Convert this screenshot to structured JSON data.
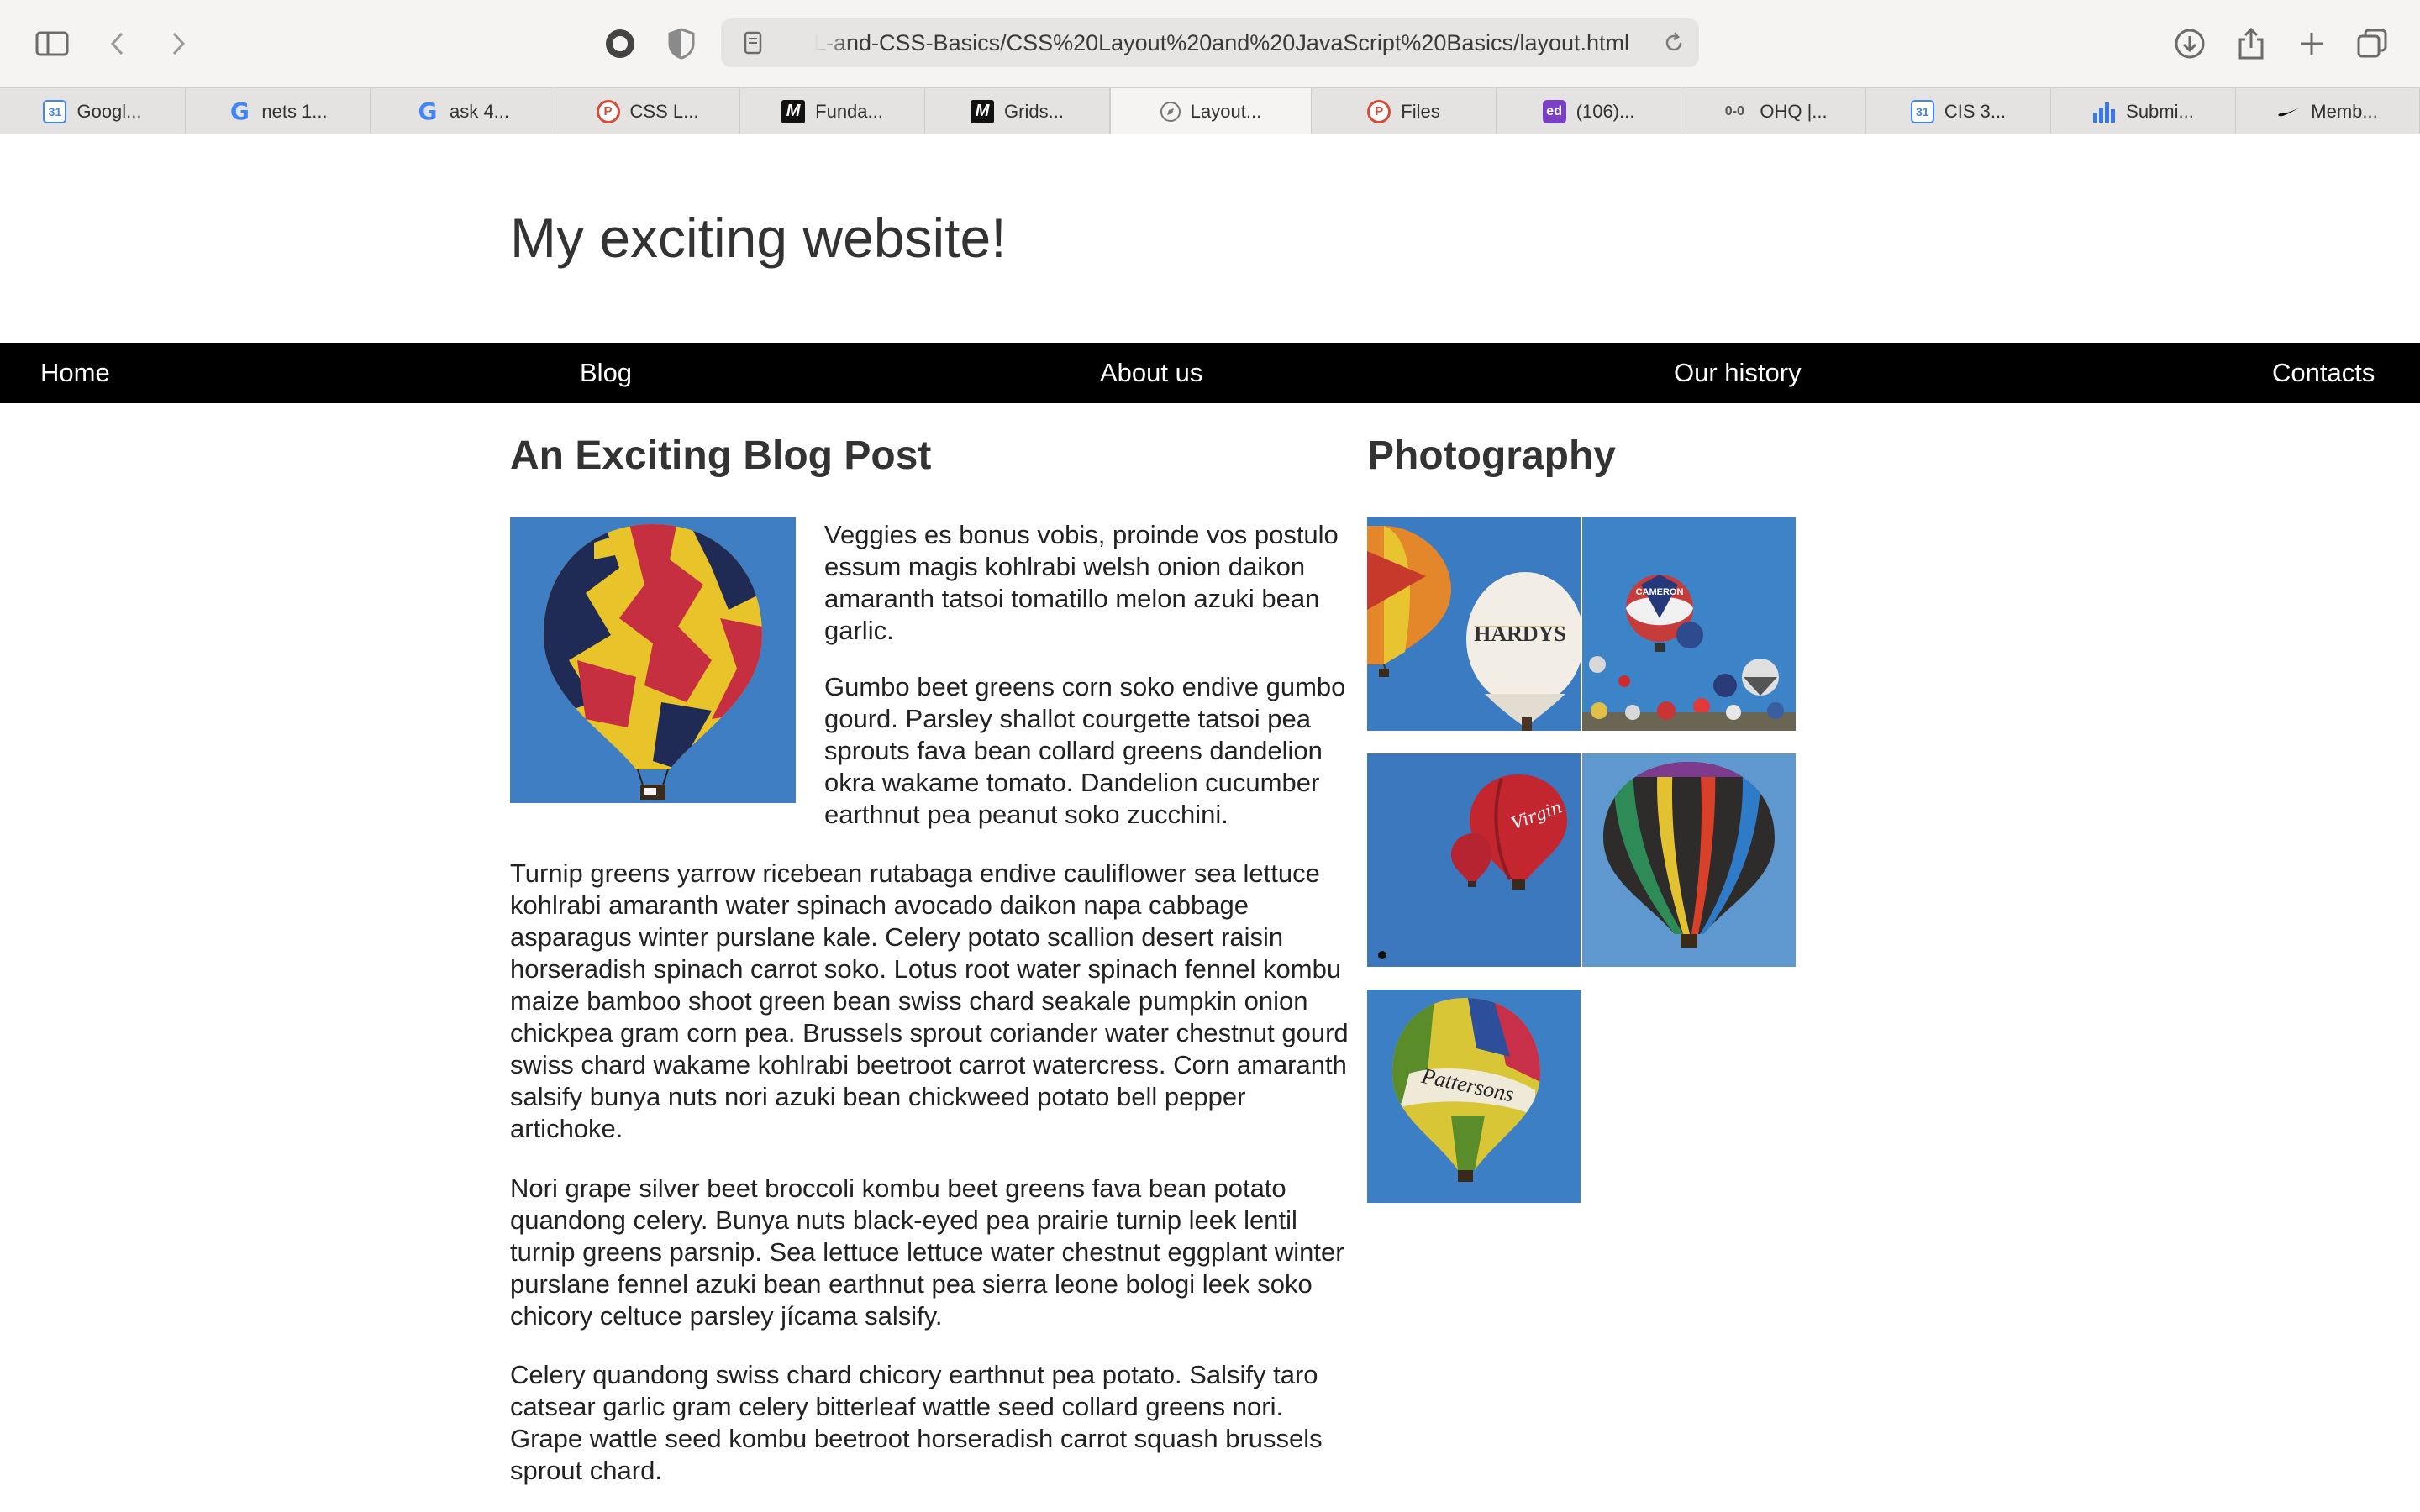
{
  "browser": {
    "url": "L-and-CSS-Basics/CSS%20Layout%20and%20JavaScript%20Basics/layout.html",
    "tabs": [
      {
        "label": "Googl...",
        "icon": "google-calendar-icon"
      },
      {
        "label": "nets 1...",
        "icon": "google-icon"
      },
      {
        "label": "ask 4...",
        "icon": "google-icon"
      },
      {
        "label": "CSS L...",
        "icon": "p-icon"
      },
      {
        "label": "Funda...",
        "icon": "m-icon"
      },
      {
        "label": "Grids...",
        "icon": "m-icon"
      },
      {
        "label": "Layout...",
        "icon": "compass-icon",
        "active": true
      },
      {
        "label": "Files",
        "icon": "p-icon"
      },
      {
        "label": "(106)...",
        "icon": "ed-icon"
      },
      {
        "label": "OHQ |...",
        "icon": "ohq-icon"
      },
      {
        "label": "CIS 3...",
        "icon": "google-calendar-icon"
      },
      {
        "label": "Submi...",
        "icon": "bar-chart-icon"
      },
      {
        "label": "Memb...",
        "icon": "nike-icon"
      }
    ]
  },
  "site": {
    "title": "My exciting website!",
    "nav": [
      "Home",
      "Blog",
      "About us",
      "Our history",
      "Contacts"
    ]
  },
  "post": {
    "title": "An Exciting Blog Post",
    "paragraphs": [
      "Veggies es bonus vobis, proinde vos postulo essum magis kohlrabi welsh onion daikon amaranth tatsoi tomatillo melon azuki bean garlic.",
      "Gumbo beet greens corn soko endive gumbo gourd. Parsley shallot courgette tatsoi pea sprouts fava bean collard greens dandelion okra wakame tomato. Dandelion cucumber earthnut pea peanut soko zucchini.",
      "Turnip greens yarrow ricebean rutabaga endive cauliflower sea lettuce kohlrabi amaranth water spinach avocado daikon napa cabbage asparagus winter purslane kale. Celery potato scallion desert raisin horseradish spinach carrot soko. Lotus root water spinach fennel kombu maize bamboo shoot green bean swiss chard seakale pumpkin onion chickpea gram corn pea. Brussels sprout coriander water chestnut gourd swiss chard wakame kohlrabi beetroot carrot watercress. Corn amaranth salsify bunya nuts nori azuki bean chickweed potato bell pepper artichoke.",
      "Nori grape silver beet broccoli kombu beet greens fava bean potato quandong celery. Bunya nuts black-eyed pea prairie turnip leek lentil turnip greens parsnip. Sea lettuce lettuce water chestnut eggplant winter purslane fennel azuki bean earthnut pea sierra leone bologi leek soko chicory celtuce parsley jícama salsify.",
      "Celery quandong swiss chard chicory earthnut pea potato. Salsify taro catsear garlic gram celery bitterleaf wattle seed collard greens nori. Grape wattle seed kombu beetroot horseradish carrot squash brussels sprout chard."
    ]
  },
  "photography": {
    "title": "Photography",
    "photos": [
      {
        "caption": "HARDYS"
      },
      {
        "caption": "CAMERON"
      },
      {
        "caption": "Virgin"
      },
      {
        "caption": ""
      },
      {
        "caption": "Pattersons"
      }
    ]
  }
}
